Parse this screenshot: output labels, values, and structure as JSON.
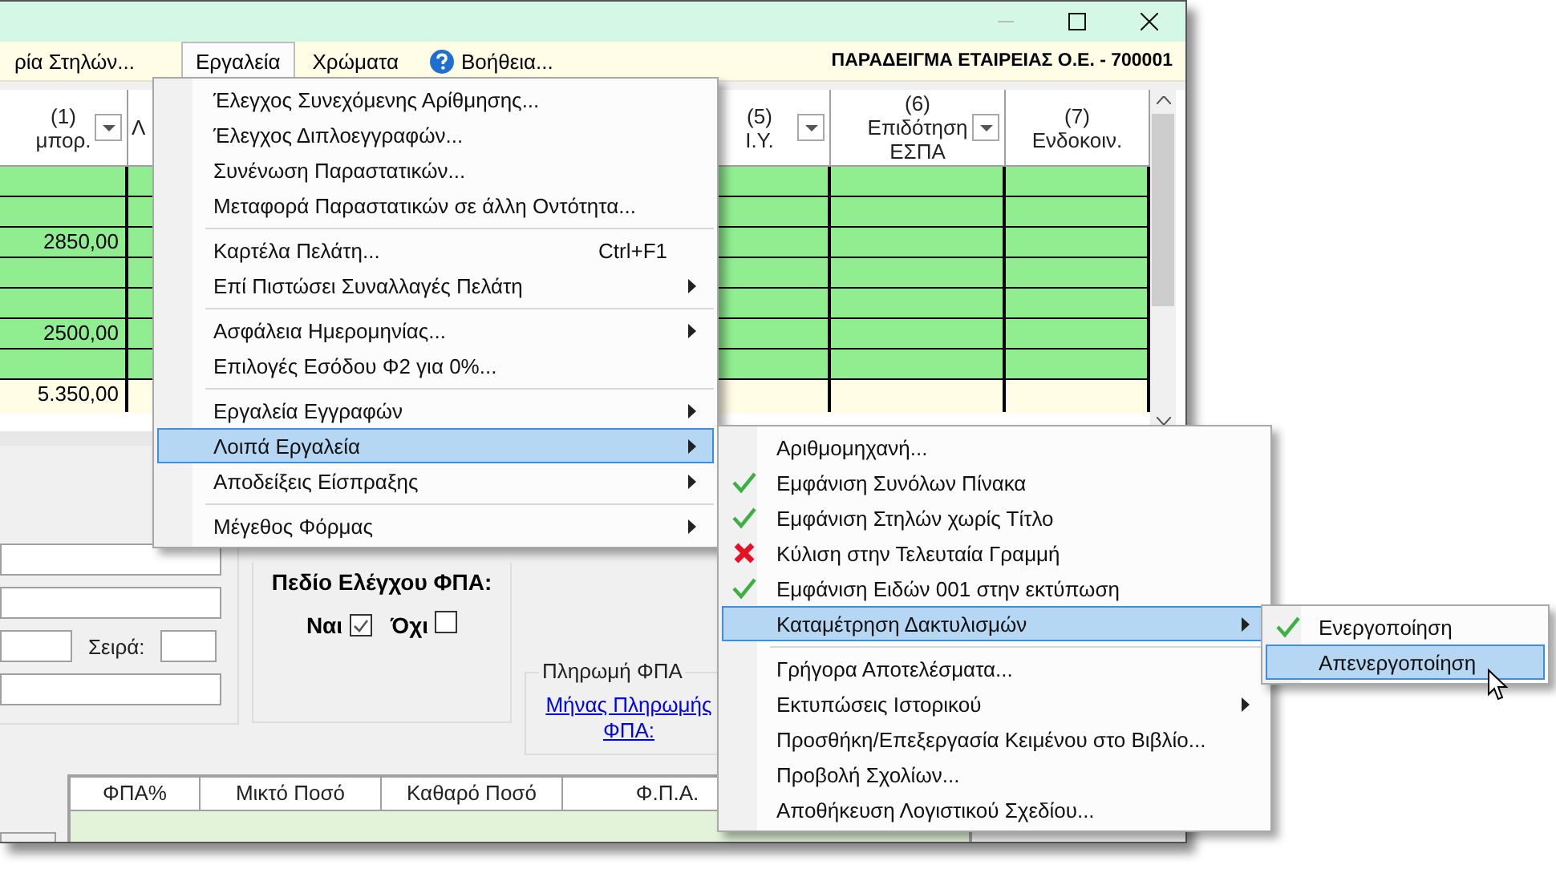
{
  "menu_bar": {
    "items": [
      {
        "label": "ρία Στηλών...",
        "kind": "text",
        "open": false
      },
      {
        "label": "Εργαλεία",
        "kind": "text",
        "open": true
      },
      {
        "label": "Χρώματα",
        "kind": "text",
        "open": false
      },
      {
        "label": "Βοήθεια...",
        "kind": "help",
        "open": false
      }
    ],
    "company": "ΠΑΡΑΔΕΙΓΜΑ ΕΤΑΙΡΕΙΑΣ Ο.Ε. - 700001"
  },
  "grid": {
    "columns": [
      {
        "number": "(1)",
        "title": "μπορ.",
        "filter": true
      },
      {
        "title": "Λ",
        "filter": false
      },
      {
        "number": "(5)",
        "title": "Ι.Υ.",
        "filter": true
      },
      {
        "number": "(6)",
        "title": "Επιδότηση ΕΣΠΑ",
        "filter": true
      },
      {
        "number": "(7)",
        "title": "Ενδοκοιν.",
        "filter": false
      }
    ],
    "rows": [
      {
        "kind": "blank"
      },
      {
        "kind": "blank"
      },
      {
        "kind": "value",
        "amount": "2850,00"
      },
      {
        "kind": "blank"
      },
      {
        "kind": "blank"
      },
      {
        "kind": "value",
        "amount": "2500,00"
      },
      {
        "kind": "blank"
      }
    ],
    "total": "5.350,00"
  },
  "form": {
    "series_label": "Σειρά:",
    "vat_check": {
      "title": "Πεδίο Ελέγχου ΦΠΑ:",
      "options": [
        {
          "label": "Ναι",
          "checked": true
        },
        {
          "label": "Όχι",
          "checked": false
        }
      ]
    },
    "vat_payment": {
      "title": "Πληρωμή ΦΠΑ",
      "link": "Μήνας Πληρωμής ΦΠΑ:"
    },
    "vat_table": {
      "columns": [
        "ΦΠΑ%",
        "Μικτό Ποσό",
        "Καθαρό Ποσό",
        "Φ.Π.Α."
      ]
    }
  },
  "tools_menu": [
    {
      "kind": "item",
      "label": "Έλεγχος Συνεχόμενης Αρίθμησης...",
      "arrow": false,
      "selected": false
    },
    {
      "kind": "item",
      "label": "Έλεγχος Διπλοεγγραφών...",
      "arrow": false,
      "selected": false
    },
    {
      "kind": "item",
      "label": "Συνένωση Παραστατικών...",
      "arrow": false,
      "selected": false
    },
    {
      "kind": "item",
      "label": "Μεταφορά Παραστατικών σε άλλη Οντότητα...",
      "arrow": false,
      "selected": false
    },
    {
      "kind": "separator"
    },
    {
      "kind": "item",
      "label": "Καρτέλα Πελάτη...",
      "shortcut": "Ctrl+F1",
      "arrow": false,
      "selected": false
    },
    {
      "kind": "item",
      "label": "Επί Πιστώσει Συναλλαγές Πελάτη",
      "arrow": true,
      "selected": false
    },
    {
      "kind": "separator"
    },
    {
      "kind": "item",
      "label": "Ασφάλεια Ημερομηνίας...",
      "arrow": true,
      "selected": false
    },
    {
      "kind": "item",
      "label": "Επιλογές Εσόδου Φ2 για 0%...",
      "arrow": false,
      "selected": false
    },
    {
      "kind": "separator"
    },
    {
      "kind": "item",
      "label": "Εργαλεία Εγγραφών",
      "arrow": true,
      "selected": false
    },
    {
      "kind": "item",
      "label": "Λοιπά Εργαλεία",
      "arrow": true,
      "selected": true
    },
    {
      "kind": "item",
      "label": "Αποδείξεις Είσπραξης",
      "arrow": true,
      "selected": false
    },
    {
      "kind": "separator"
    },
    {
      "kind": "item",
      "label": "Μέγεθος Φόρμας",
      "arrow": true,
      "selected": false
    }
  ],
  "other_tools_menu": [
    {
      "kind": "item",
      "label": "Αριθμομηχανή...",
      "arrow": false,
      "selected": false
    },
    {
      "kind": "check",
      "label": "Εμφάνιση Συνόλων Πίνακα",
      "arrow": false,
      "selected": false
    },
    {
      "kind": "check",
      "label": "Εμφάνιση Στηλών χωρίς Τίτλο",
      "arrow": false,
      "selected": false
    },
    {
      "kind": "cross",
      "label": "Κύλιση στην Τελευταία Γραμμή",
      "arrow": false,
      "selected": false
    },
    {
      "kind": "check",
      "label": "Εμφάνιση Ειδών 001 στην εκτύπωση",
      "arrow": false,
      "selected": false
    },
    {
      "kind": "item",
      "label": "Καταμέτρηση Δακτυλισμών",
      "arrow": true,
      "selected": true
    },
    {
      "kind": "separator"
    },
    {
      "kind": "item",
      "label": "Γρήγορα Αποτελέσματα...",
      "arrow": false,
      "selected": false
    },
    {
      "kind": "item",
      "label": "Εκτυπώσεις Ιστορικού",
      "arrow": true,
      "selected": false
    },
    {
      "kind": "item",
      "label": "Προσθήκη/Επεξεργασία Κειμένου στο Βιβλίο...",
      "arrow": false,
      "selected": false
    },
    {
      "kind": "item",
      "label": "Προβολή Σχολίων...",
      "arrow": false,
      "selected": false
    },
    {
      "kind": "item",
      "label": "Αποθήκευση Λογιστικού Σχεδίου...",
      "arrow": false,
      "selected": false
    }
  ],
  "counting_menu": [
    {
      "kind": "check",
      "label": "Ενεργοποίηση",
      "arrow": false,
      "selected": false
    },
    {
      "kind": "item",
      "label": "Απενεργοποίηση",
      "arrow": false,
      "selected": true
    }
  ]
}
